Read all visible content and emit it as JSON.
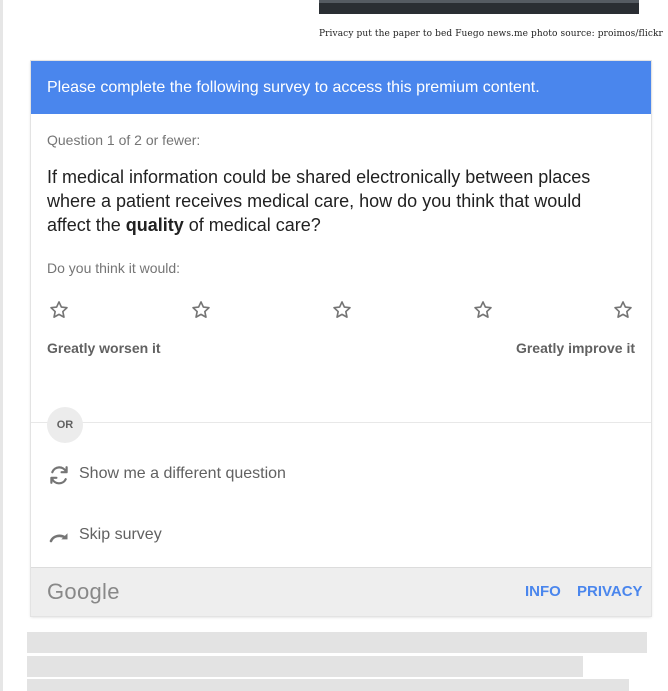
{
  "caption": "Privacy put the paper to bed Fuego news.me photo source: proimos/flickr",
  "survey": {
    "banner": "Please complete the following survey to access this premium content.",
    "question_count": "Question 1 of 2 or fewer:",
    "question_pre": "If medical information could be shared electronically between places where a patient receives medical care, how do you think that would affect the ",
    "question_bold": "quality",
    "question_post": " of medical care?",
    "prompt": "Do you think it would:",
    "rating_count": 5,
    "rating_value": 0,
    "label_low": "Greatly worsen it",
    "label_high": "Greatly improve it",
    "or_label": "OR",
    "different_question": "Show me a different question",
    "skip": "Skip survey"
  },
  "footer": {
    "logo": "Google",
    "info": "INFO",
    "privacy": "PRIVACY"
  },
  "colors": {
    "accent": "#4a86ed",
    "placeholder": "#e3e3e3"
  }
}
